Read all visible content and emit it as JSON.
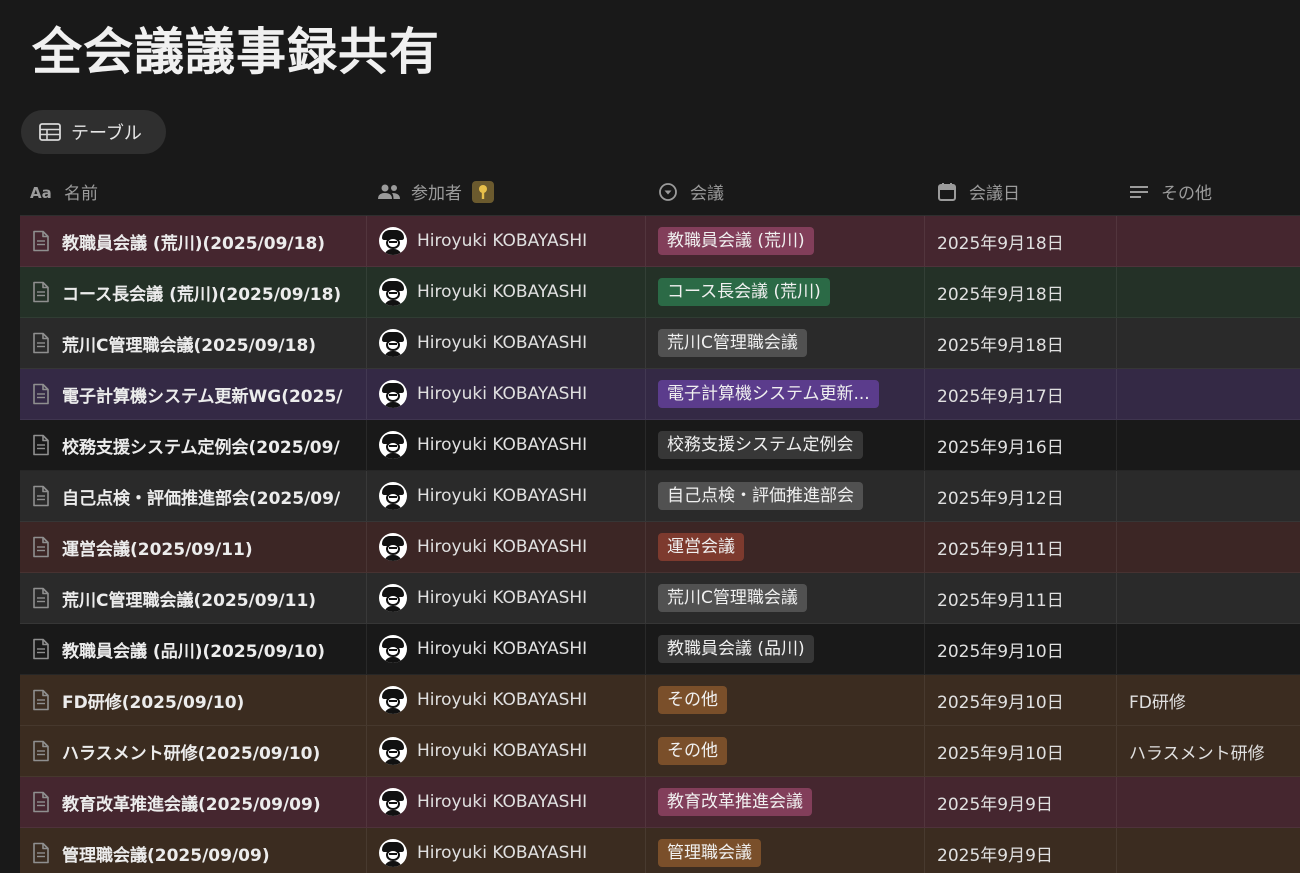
{
  "title": "全会議議事録共有",
  "view": {
    "label": "テーブル",
    "icon": "table-icon"
  },
  "columns": [
    {
      "label": "名前",
      "icon": "text-property-icon"
    },
    {
      "label": "参加者",
      "icon": "people-icon"
    },
    {
      "label": "会議",
      "icon": "select-icon"
    },
    {
      "label": "会議日",
      "icon": "calendar-icon"
    },
    {
      "label": "その他",
      "icon": "text-lines-icon"
    }
  ],
  "colors": {
    "pink_row": "#45262f",
    "pink_tag": "#823e5a",
    "green_row": "#243127",
    "green_tag": "#2b6a46",
    "gray_row": "#2a2a2a",
    "gray_tag": "#515151",
    "purple_row": "#342945",
    "purple_tag": "#5b3c8c",
    "default_row": "#191919",
    "default_tag": "#373737",
    "red_row": "#3c2625",
    "red_tag": "#7d3a2e",
    "brown_row": "#3b2c20",
    "brown_tag": "#7a4f2a"
  },
  "rows": [
    {
      "name": "教職員会議 (荒川)(2025/09/18)",
      "participant": "Hiroyuki KOBAYASHI",
      "meeting": "教職員会議 (荒川)",
      "color": "pink",
      "date": "2025年9月18日",
      "other": ""
    },
    {
      "name": "コース長会議 (荒川)(2025/09/18)",
      "participant": "Hiroyuki KOBAYASHI",
      "meeting": "コース長会議 (荒川)",
      "color": "green",
      "date": "2025年9月18日",
      "other": ""
    },
    {
      "name": "荒川C管理職会議(2025/09/18)",
      "participant": "Hiroyuki KOBAYASHI",
      "meeting": "荒川C管理職会議",
      "color": "gray",
      "date": "2025年9月18日",
      "other": ""
    },
    {
      "name": "電子計算機システム更新WG(2025/",
      "participant": "Hiroyuki KOBAYASHI",
      "meeting": "電子計算機システム更新...",
      "color": "purple",
      "date": "2025年9月17日",
      "other": ""
    },
    {
      "name": "校務支援システム定例会(2025/09/",
      "participant": "Hiroyuki KOBAYASHI",
      "meeting": "校務支援システム定例会",
      "color": "default",
      "date": "2025年9月16日",
      "other": ""
    },
    {
      "name": "自己点検・評価推進部会(2025/09/",
      "participant": "Hiroyuki KOBAYASHI",
      "meeting": "自己点検・評価推進部会",
      "color": "gray",
      "date": "2025年9月12日",
      "other": ""
    },
    {
      "name": "運営会議(2025/09/11)",
      "participant": "Hiroyuki KOBAYASHI",
      "meeting": "運営会議",
      "color": "red",
      "date": "2025年9月11日",
      "other": ""
    },
    {
      "name": "荒川C管理職会議(2025/09/11)",
      "participant": "Hiroyuki KOBAYASHI",
      "meeting": "荒川C管理職会議",
      "color": "gray",
      "date": "2025年9月11日",
      "other": ""
    },
    {
      "name": "教職員会議 (品川)(2025/09/10)",
      "participant": "Hiroyuki KOBAYASHI",
      "meeting": "教職員会議 (品川)",
      "color": "default",
      "date": "2025年9月10日",
      "other": ""
    },
    {
      "name": "FD研修(2025/09/10)",
      "participant": "Hiroyuki KOBAYASHI",
      "meeting": "その他",
      "color": "brown",
      "date": "2025年9月10日",
      "other": "FD研修"
    },
    {
      "name": "ハラスメント研修(2025/09/10)",
      "participant": "Hiroyuki KOBAYASHI",
      "meeting": "その他",
      "color": "brown",
      "date": "2025年9月10日",
      "other": "ハラスメント研修"
    },
    {
      "name": "教育改革推進会議(2025/09/09)",
      "participant": "Hiroyuki KOBAYASHI",
      "meeting": "教育改革推進会議",
      "color": "pink",
      "date": "2025年9月9日",
      "other": ""
    },
    {
      "name": "管理職会議(2025/09/09)",
      "participant": "Hiroyuki KOBAYASHI",
      "meeting": "管理職会議",
      "color": "brown",
      "date": "2025年9月9日",
      "other": ""
    }
  ]
}
